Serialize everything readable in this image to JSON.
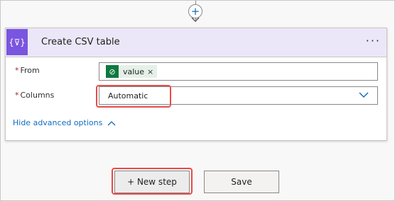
{
  "connector": {
    "add_symbol": "+"
  },
  "card": {
    "icon_glyph": "{⊽}",
    "title": "Create CSV table",
    "more_glyph": "···",
    "fields": {
      "from": {
        "required_mark": "*",
        "label": "From",
        "token": {
          "text": "value",
          "remove_glyph": "×",
          "icon_glyph": "⊘"
        }
      },
      "columns": {
        "required_mark": "*",
        "label": "Columns",
        "value": "Automatic"
      }
    },
    "advanced_link": "Hide advanced options"
  },
  "footer": {
    "new_step_label": "+ New step",
    "save_label": "Save"
  },
  "colors": {
    "accent": "#7a55e0",
    "link": "#0f6cbd",
    "highlight": "#e84b4b",
    "token_icon": "#0b7a3e"
  },
  "icons": [
    "add-step-icon",
    "arrow-down-icon",
    "variable-icon",
    "more-options-icon",
    "dataverse-icon",
    "remove-token-icon",
    "chevron-down-icon",
    "chevron-up-icon"
  ]
}
